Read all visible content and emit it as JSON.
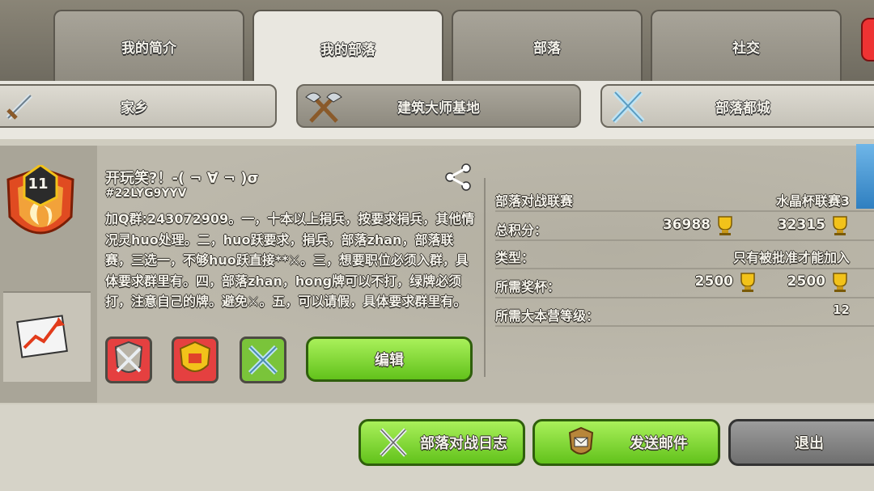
{
  "tabs": [
    {
      "label": "我的简介"
    },
    {
      "label": "我的部落"
    },
    {
      "label": "部落"
    },
    {
      "label": "社交"
    }
  ],
  "subtabs": [
    {
      "label": "家乡"
    },
    {
      "label": "建筑大师基地"
    },
    {
      "label": "部落都城"
    }
  ],
  "clan": {
    "level": "11",
    "name": "开玩笑?！-( ¬ ∀ ¬ )σ",
    "tag": "#22LYG9YYV",
    "description": "加Q群:243072909。一，十本以上捐兵，按要求捐兵，其他情况灵huo处理。二，huo跃要求，捐兵，部落zhan，部落联赛，三选一，不够huo跃直接**⚔。三，想要职位必须入群，具体要求群里有。四，部落zhan，hong牌可以不打，绿牌必须打，注意自己的牌。避免⚔。五，可以请假，具体要求群里有。",
    "edit_label": "编辑"
  },
  "stats": {
    "war_league_label": "部落对战联赛",
    "war_league_value": "水晶杯联赛3",
    "total_points_label": "总积分：",
    "total_points_1": "36988",
    "total_points_2": "32315",
    "type_label": "类型：",
    "type_value": "只有被批准才能加入",
    "required_trophies_label": "所需奖杯：",
    "required_trophies_1": "2500",
    "required_trophies_2": "2500",
    "required_th_label": "所需大本营等级：",
    "required_th_value": "12"
  },
  "bottom": {
    "war_log_label": "部落对战日志",
    "send_mail_label": "发送邮件",
    "leave_label": "退出"
  },
  "colors": {
    "green": "#62c21b",
    "trophy": "#f2c21a",
    "badge_red": "#e04b21"
  }
}
